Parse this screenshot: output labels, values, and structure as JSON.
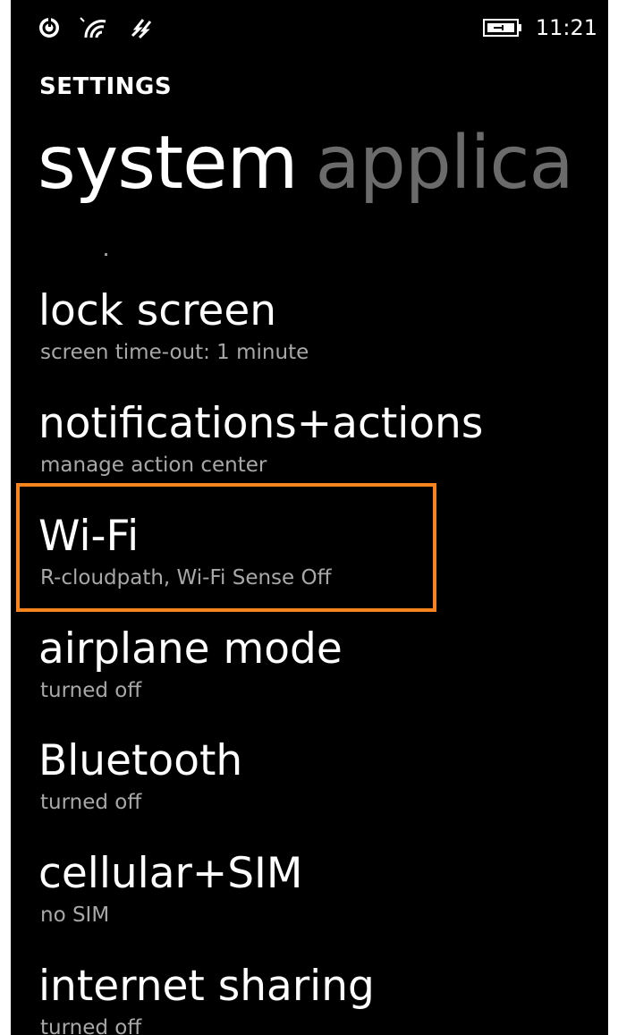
{
  "status_bar": {
    "icons": [
      "nfc-icon",
      "wifi-signal-icon",
      "data-sync-icon"
    ],
    "battery_icon": "battery-charging-icon",
    "time": "11:21"
  },
  "header": {
    "app_title": "SETTINGS",
    "pivot_active": "system",
    "pivot_next": "applica"
  },
  "settings": {
    "items": [
      {
        "title": "lock screen",
        "subtitle": "screen time-out: 1 minute"
      },
      {
        "title": "notifications+actions",
        "subtitle": "manage action center"
      },
      {
        "title": "Wi-Fi",
        "subtitle": "R-cloudpath, Wi-Fi Sense Off"
      },
      {
        "title": "airplane mode",
        "subtitle": "turned off"
      },
      {
        "title": "Bluetooth",
        "subtitle": "turned off"
      },
      {
        "title": "cellular+SIM",
        "subtitle": "no SIM"
      },
      {
        "title": "internet sharing",
        "subtitle": "turned off"
      }
    ]
  },
  "colors": {
    "background": "#000000",
    "text_primary": "#ffffff",
    "text_secondary": "#a8a8a8",
    "pivot_inactive": "#6b6b6b",
    "highlight": "#f5841f"
  }
}
